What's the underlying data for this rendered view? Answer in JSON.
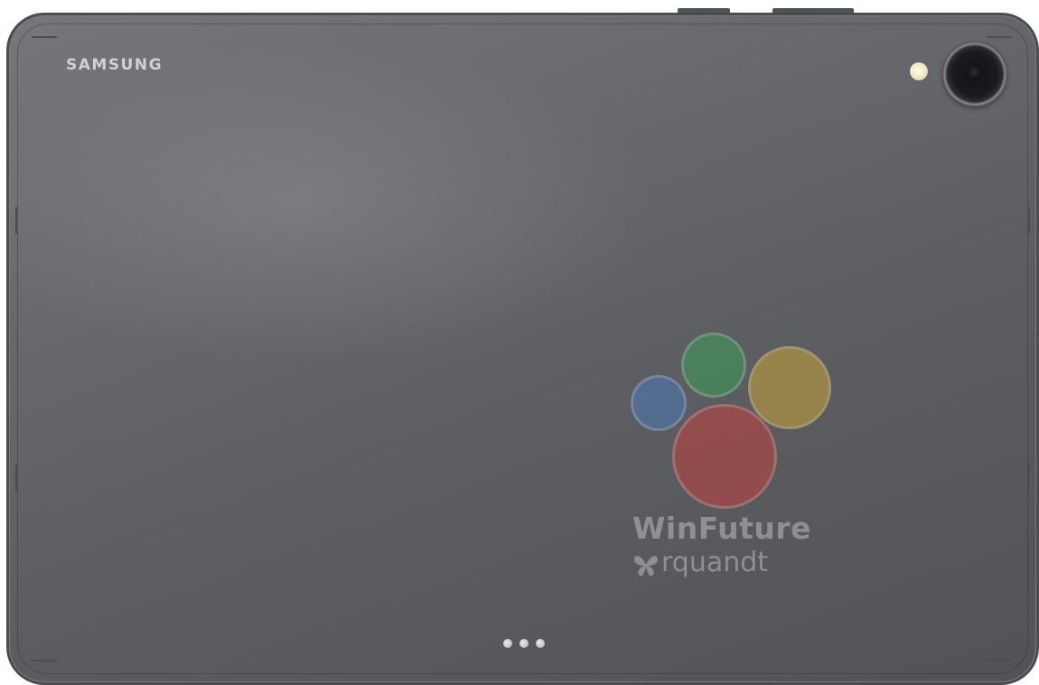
{
  "image": {
    "subject": "tablet-back",
    "body_color": "#64666a"
  },
  "brand": {
    "logo_text": "SAMSUNG"
  },
  "watermark": {
    "line1": "WinFuture",
    "line2": "rquandt",
    "colors": [
      "#4e79b5",
      "#3d9c58",
      "#c7a43a",
      "#c0413d"
    ]
  },
  "hardware": {
    "camera": "rear-camera-lens",
    "flash": "led-flash",
    "keyboard_pins": 3
  }
}
